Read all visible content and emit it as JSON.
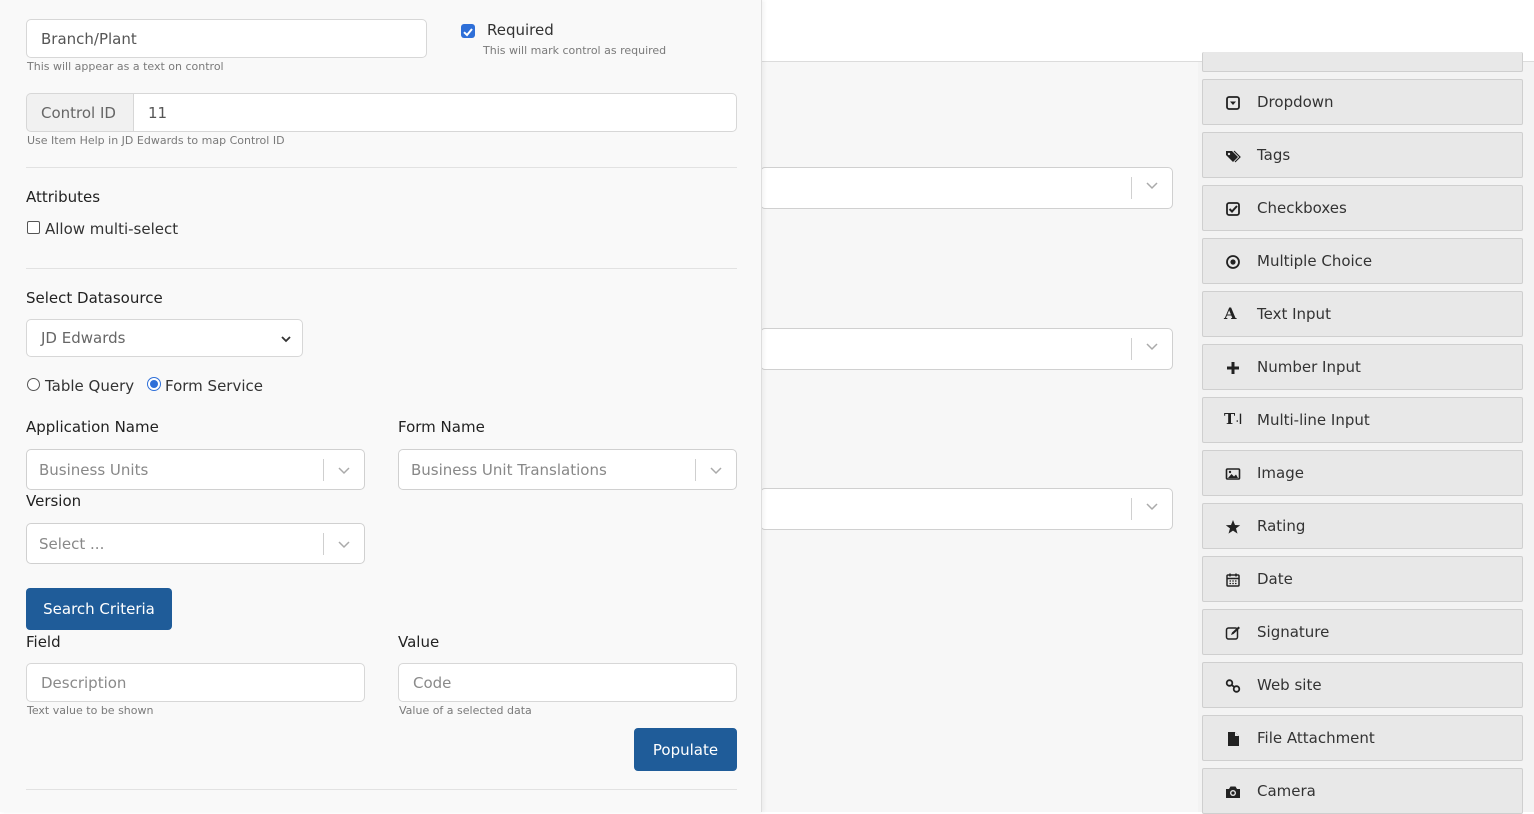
{
  "panel": {
    "label_field": {
      "value": "Branch/Plant",
      "help": "This will appear as a text on control"
    },
    "required": {
      "label": "Required",
      "help": "This will mark control as required",
      "checked": true
    },
    "control_id": {
      "addon": "Control ID",
      "value": "11",
      "help": "Use Item Help in JD Edwards to map Control ID"
    },
    "attributes": {
      "heading": "Attributes",
      "multi_select_label": "Allow multi-select"
    },
    "datasource": {
      "heading": "Select Datasource",
      "selected": "JD Edwards",
      "radio_table_query": "Table Query",
      "radio_form_service": "Form Service",
      "selected_mode": "Form Service"
    },
    "application": {
      "heading": "Application Name",
      "value": "Business Units"
    },
    "form": {
      "heading": "Form Name",
      "value": "Business Unit Translations"
    },
    "version": {
      "heading": "Version",
      "placeholder": "Select ..."
    },
    "search_criteria_button": "Search Criteria",
    "field": {
      "heading": "Field",
      "placeholder": "Description",
      "help": "Text value to be shown"
    },
    "value": {
      "heading": "Value",
      "placeholder": "Code",
      "help": "Value of a selected data"
    },
    "populate_button": "Populate"
  },
  "palette": {
    "items": [
      {
        "label": "Dropdown",
        "icon": "dropdown-icon"
      },
      {
        "label": "Tags",
        "icon": "tags-icon"
      },
      {
        "label": "Checkboxes",
        "icon": "checkbox-icon"
      },
      {
        "label": "Multiple Choice",
        "icon": "radio-icon"
      },
      {
        "label": "Text Input",
        "icon": "text-icon"
      },
      {
        "label": "Number Input",
        "icon": "plus-icon"
      },
      {
        "label": "Multi-line Input",
        "icon": "multiline-text-icon"
      },
      {
        "label": "Image",
        "icon": "image-icon"
      },
      {
        "label": "Rating",
        "icon": "star-icon"
      },
      {
        "label": "Date",
        "icon": "calendar-icon"
      },
      {
        "label": "Signature",
        "icon": "pen-icon"
      },
      {
        "label": "Web site",
        "icon": "link-icon"
      },
      {
        "label": "File Attachment",
        "icon": "file-icon"
      },
      {
        "label": "Camera",
        "icon": "camera-icon"
      }
    ]
  },
  "colors": {
    "primary_button": "#1f5c99",
    "checkbox_accent": "#2e6fd8"
  }
}
